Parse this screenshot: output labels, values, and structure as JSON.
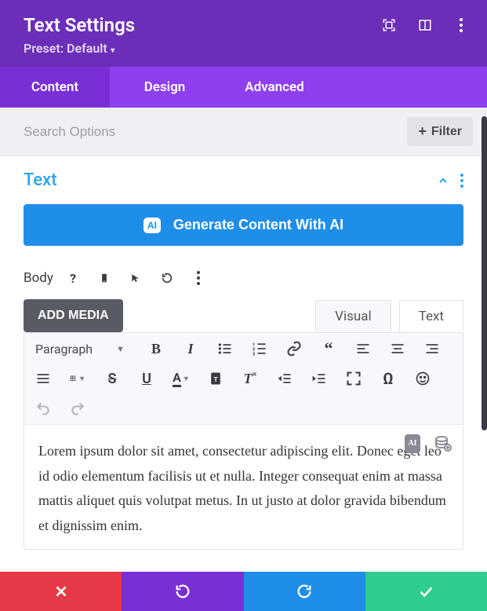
{
  "header": {
    "title": "Text Settings",
    "preset_label": "Preset: Default"
  },
  "tabs": {
    "content": "Content",
    "design": "Design",
    "advanced": "Advanced"
  },
  "search": {
    "placeholder": "Search Options",
    "filter_label": "Filter"
  },
  "section": {
    "title": "Text",
    "ai_button": "Generate Content With AI",
    "ai_badge": "AI",
    "body_label": "Body",
    "add_media": "ADD MEDIA",
    "editor_tabs": {
      "visual": "Visual",
      "text": "Text"
    },
    "format_select": "Paragraph",
    "content_text": "Lorem ipsum dolor sit amet, consectetur adipiscing elit. Donec eget leo id odio elementum facilisis ut et nulla. Integer consequat enim at massa mattis aliquet quis volutpat metus. In ut justo at dolor gravida bibendum et dignissim enim."
  }
}
